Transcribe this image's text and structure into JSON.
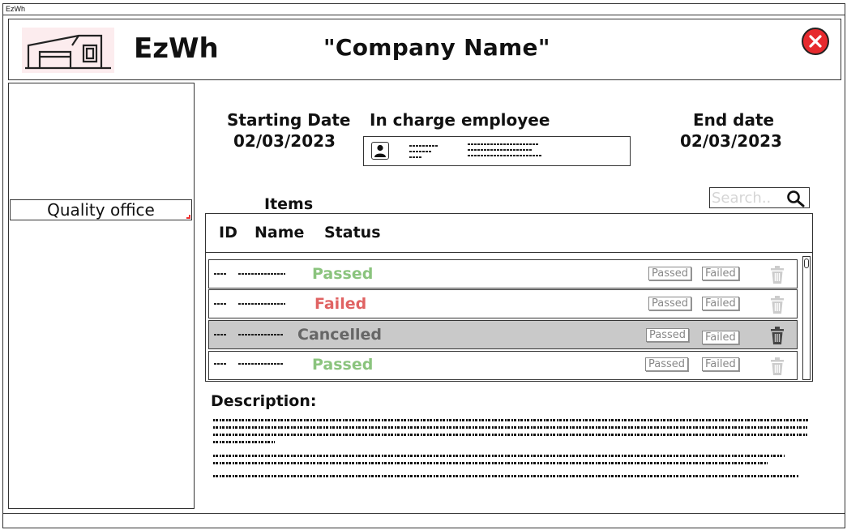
{
  "window": {
    "title": "EzWh"
  },
  "header": {
    "app_name": "EzWh",
    "company_name": "\"Company Name\""
  },
  "sidebar": {
    "items": [
      {
        "label": "Quality office"
      }
    ]
  },
  "details": {
    "start_label": "Starting Date",
    "start_value": "02/03/2023",
    "employee_label": "In charge employee",
    "end_label": "End date",
    "end_value": "02/03/2023"
  },
  "items_section": {
    "label": "Items",
    "search_placeholder": "Search.."
  },
  "table": {
    "columns": [
      "ID",
      "Name",
      "Status"
    ],
    "rows": [
      {
        "status": "Passed",
        "status_class": "passed",
        "selected": false
      },
      {
        "status": "Failed",
        "status_class": "failed",
        "selected": false
      },
      {
        "status": "Cancelled",
        "status_class": "cancelled",
        "selected": true
      },
      {
        "status": "Passed",
        "status_class": "passed",
        "selected": false
      }
    ],
    "passed_btn": "Passed",
    "failed_btn": "Failed"
  },
  "description": {
    "label": "Description:"
  },
  "colors": {
    "passed": "#8bc47e",
    "failed": "#e06363",
    "cancelled": "#666666",
    "close": "#e62a2e",
    "selected_row": "#c9c9c9"
  },
  "icons": [
    "warehouse-logo-icon",
    "close-icon",
    "user-icon",
    "search-icon",
    "trash-icon"
  ]
}
